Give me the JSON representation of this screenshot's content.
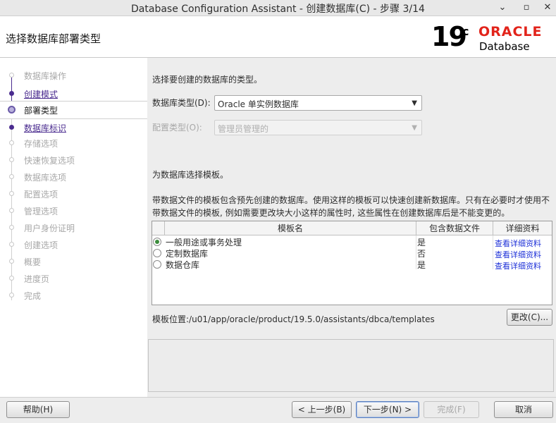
{
  "window": {
    "title": "Database Configuration Assistant - 创建数据库(C) - 步骤 3/14",
    "minimize": "⌄",
    "maximize": "▫",
    "close": "✕"
  },
  "header": {
    "page_title": "选择数据库部署类型",
    "logo_version": "19",
    "logo_suffix": "c",
    "logo_brand": "ORACLE",
    "logo_product": "Database"
  },
  "sidebar": {
    "items": [
      {
        "label": "数据库操作",
        "state": "future"
      },
      {
        "label": "创建模式",
        "state": "done"
      },
      {
        "label": "部署类型",
        "state": "current"
      },
      {
        "label": "数据库标识",
        "state": "done"
      },
      {
        "label": "存储选项",
        "state": "future"
      },
      {
        "label": "快速恢复选项",
        "state": "future"
      },
      {
        "label": "数据库选项",
        "state": "future"
      },
      {
        "label": "配置选项",
        "state": "future"
      },
      {
        "label": "管理选项",
        "state": "future"
      },
      {
        "label": "用户身份证明",
        "state": "future"
      },
      {
        "label": "创建选项",
        "state": "future"
      },
      {
        "label": "概要",
        "state": "future"
      },
      {
        "label": "进度页",
        "state": "future"
      },
      {
        "label": "完成",
        "state": "future"
      }
    ]
  },
  "main": {
    "intro": "选择要创建的数据库的类型。",
    "db_type_label": "数据库类型(D):",
    "db_type_value": "Oracle 单实例数据库",
    "config_type_label": "配置类型(O):",
    "config_type_value": "管理员管理的",
    "template_prompt": "为数据库选择模板。",
    "template_desc_line1": "带数据文件的模板包含预先创建的数据库。使用这样的模板可以快速创建新数据库。只有在必要时才使用不",
    "template_desc_line2": "带数据文件的模板, 例如需要更改块大小这样的属性时, 这些属性在创建数据库后是不能变更的。",
    "table": {
      "headers": [
        "模板名",
        "包含数据文件",
        "详细资料"
      ],
      "rows": [
        {
          "name": "一般用途或事务处理",
          "datafiles": "是",
          "details": "查看详细资料",
          "selected": true
        },
        {
          "name": "定制数据库",
          "datafiles": "否",
          "details": "查看详细资料",
          "selected": false
        },
        {
          "name": "数据仓库",
          "datafiles": "是",
          "details": "查看详细资料",
          "selected": false
        }
      ]
    },
    "template_location": "模板位置:/u01/app/oracle/product/19.5.0/assistants/dbca/templates",
    "change_button": "更改(C)..."
  },
  "footer": {
    "help": "帮助(H)",
    "back": "< 上一步(B)",
    "next": "下一步(N) >",
    "finish": "完成(F)",
    "cancel": "取消"
  },
  "colors": {
    "oracle_red": "#e2231a",
    "step_done": "#4a2b8f",
    "link": "#1f32d8"
  }
}
